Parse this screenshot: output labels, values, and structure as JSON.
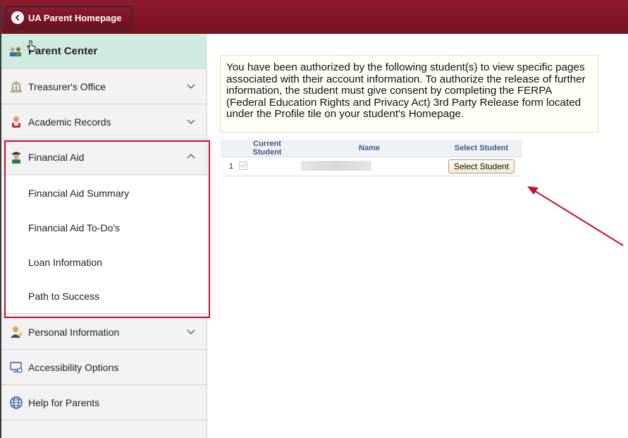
{
  "header": {
    "home_label": "UA Parent Homepage"
  },
  "sidebar": {
    "items": [
      {
        "label": "Parent Center",
        "icon": "parent-icon"
      },
      {
        "label": "Treasurer's Office",
        "icon": "bank-icon"
      },
      {
        "label": "Academic Records",
        "icon": "student-icon"
      },
      {
        "label": "Financial Aid",
        "icon": "graduate-icon"
      },
      {
        "label": "Personal Information",
        "icon": "person-icon"
      },
      {
        "label": "Accessibility Options",
        "icon": "computer-icon"
      },
      {
        "label": "Help for Parents",
        "icon": "globe-icon"
      }
    ],
    "sub_items": [
      {
        "label": "Financial Aid Summary"
      },
      {
        "label": "Financial Aid To-Do's"
      },
      {
        "label": "Loan Information"
      },
      {
        "label": "Path to Success"
      }
    ]
  },
  "main": {
    "info_text": "You have been authorized by the following student(s) to view specific pages associated with their account information. To authorize the release of further information, the student must give consent by completing the FERPA (Federal Education Rights and Privacy Act) 3rd Party Release form located under the Profile tile on your student's Homepage.",
    "table": {
      "headers": [
        "Current Student",
        "Name",
        "Select Student"
      ],
      "rows": [
        {
          "num": "1",
          "button": "Select Student"
        }
      ]
    }
  },
  "colors": {
    "brand": "#7a1021",
    "highlight": "#c8102e",
    "active_bg": "#cfeadf"
  }
}
